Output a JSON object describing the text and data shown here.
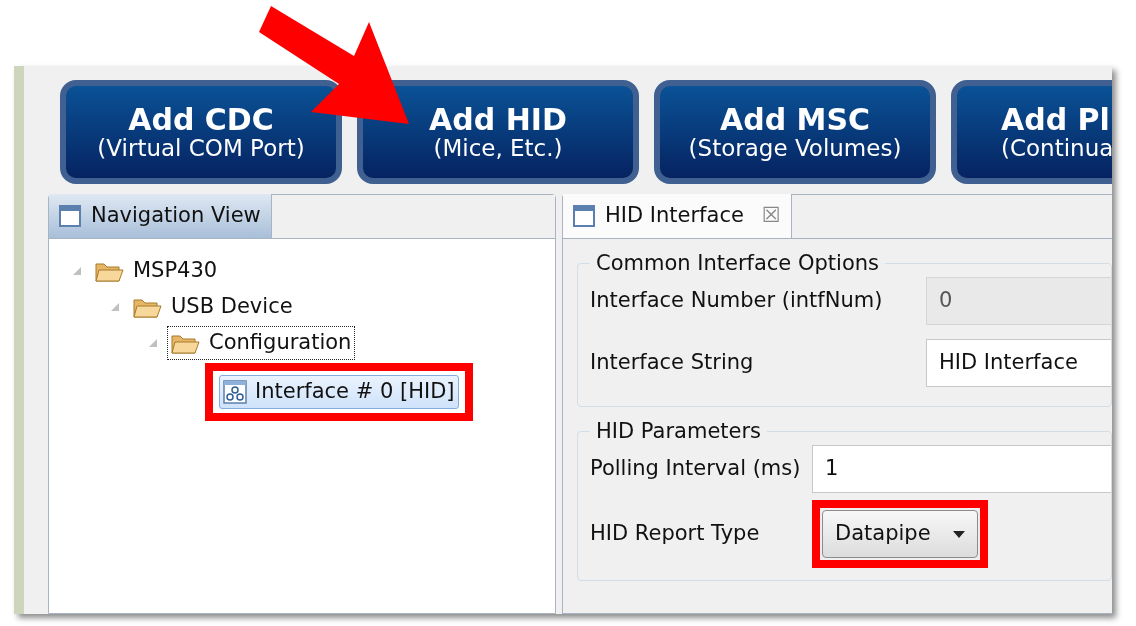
{
  "toolbar": {
    "buttons": [
      {
        "title": "Add CDC",
        "subtitle": "(Virtual COM Port)"
      },
      {
        "title": "Add HID",
        "subtitle": "(Mice, Etc.)",
        "pointed": true
      },
      {
        "title": "Add MSC",
        "subtitle": "(Storage Volumes)"
      },
      {
        "title": "Add Pl",
        "subtitle": "(Continua"
      }
    ]
  },
  "navigation_view": {
    "tab": {
      "label": "Navigation View",
      "selected": true
    },
    "tree": [
      {
        "label": "MSP430",
        "kind": "folder",
        "expanded": true,
        "selected": false,
        "children": [
          {
            "label": "USB Device",
            "kind": "folder",
            "expanded": true,
            "selected": false,
            "children": [
              {
                "label": "Configuration",
                "kind": "folder",
                "expanded": true,
                "selected": false,
                "focused": true,
                "children": [
                  {
                    "label": "Interface # 0 [HID]",
                    "kind": "interface",
                    "selected": true,
                    "highlighted": true
                  }
                ]
              }
            ]
          }
        ]
      }
    ]
  },
  "editor": {
    "tab": {
      "label": "HID Interface",
      "close": "☒",
      "selected": true
    },
    "groups": [
      {
        "title": "Common Interface Options",
        "fields": [
          {
            "label": "Interface Number (intfNum)",
            "kind": "text",
            "value": "0",
            "disabled": true
          },
          {
            "label": "Interface String",
            "kind": "text",
            "value": "HID Interface",
            "disabled": false
          }
        ]
      },
      {
        "title": "HID Parameters",
        "fields": [
          {
            "label": "Polling Interval (ms)",
            "kind": "text",
            "value": "1",
            "disabled": false
          },
          {
            "label": "HID Report Type",
            "kind": "dropdown",
            "value": "Datapipe",
            "highlighted": true
          }
        ]
      }
    ]
  }
}
